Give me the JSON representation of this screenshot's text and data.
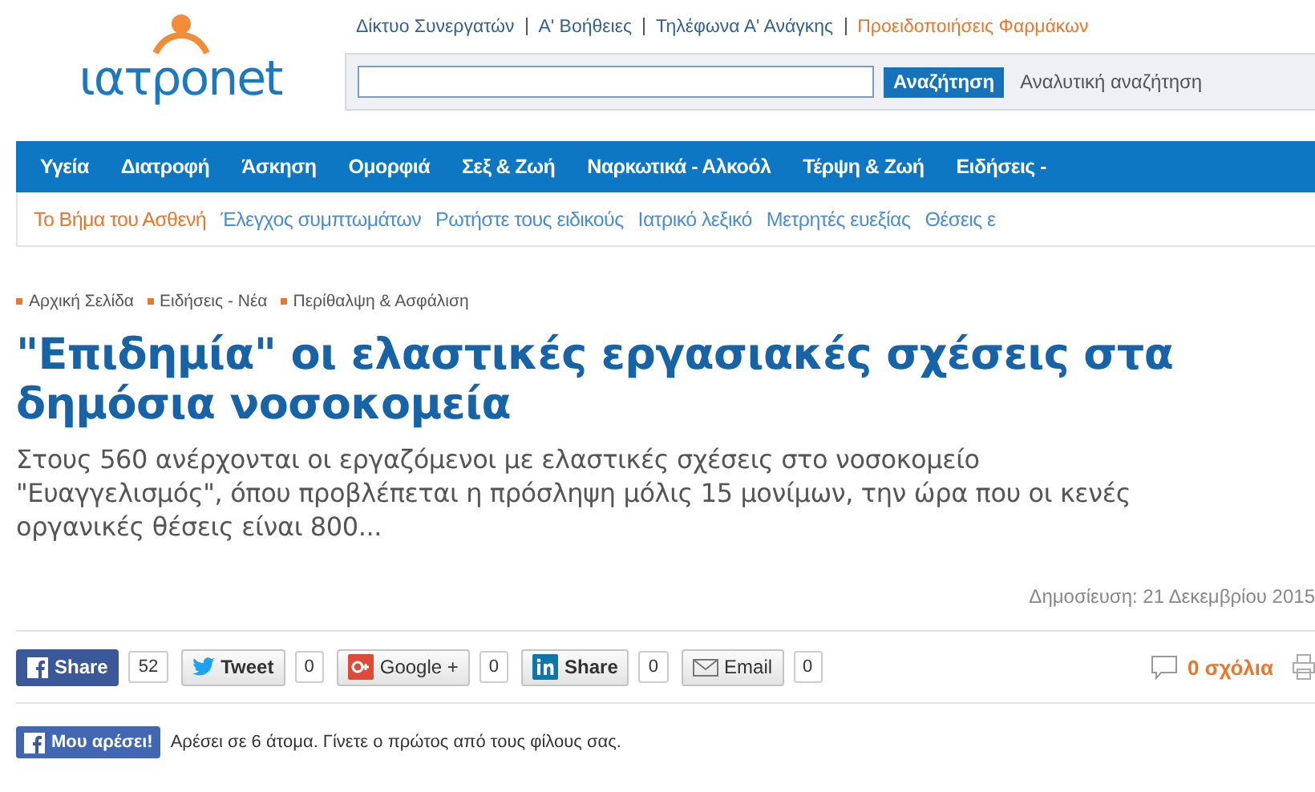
{
  "header": {
    "logo": {
      "prefix": "ιατρο",
      "suffix": "net"
    },
    "top_links": [
      {
        "label": "Δίκτυο Συνεργατών",
        "highlight": false
      },
      {
        "label": "Α' Βοήθειες",
        "highlight": false
      },
      {
        "label": "Τηλέφωνα Α' Ανάγκης",
        "highlight": false
      },
      {
        "label": "Προειδοποιήσεις Φαρμάκων",
        "highlight": true
      }
    ],
    "search": {
      "button": "Αναζήτηση",
      "advanced": "Αναλυτική αναζήτηση"
    }
  },
  "main_nav": [
    "Υγεία",
    "Διατροφή",
    "Άσκηση",
    "Ομορφιά",
    "Σεξ & Ζωή",
    "Ναρκωτικά - Αλκοόλ",
    "Τέρψη & Ζωή",
    "Ειδήσεις -"
  ],
  "sub_nav": [
    {
      "label": "Το Βήμα του Ασθενή",
      "selected": true
    },
    {
      "label": "Έλεγχος συμπτωμάτων",
      "selected": false
    },
    {
      "label": "Ρωτήστε τους ειδικούς",
      "selected": false
    },
    {
      "label": "Ιατρικό λεξικό",
      "selected": false
    },
    {
      "label": "Μετρητές ευεξίας",
      "selected": false
    },
    {
      "label": "Θέσεις ε",
      "selected": false
    }
  ],
  "breadcrumb": [
    "Αρχική Σελίδα",
    "Ειδήσεις - Νέα",
    "Περίθαλψη & Ασφάλιση"
  ],
  "article": {
    "title": "\"Επιδημία\" οι ελαστικές εργασιακές σχέσεις στα δημόσια νοσοκομεία",
    "lead": "Στους 560 ανέρχονται οι εργαζόμενοι με ελαστικές σχέσεις στο νοσοκομείο \"Ευαγγελισμός\", όπου προβλέπεται η πρόσληψη μόλις 15 μονίμων, την ώρα που οι κενές οργανικές θέσεις είναι 800...",
    "published": "Δημοσίευση: 21 Δεκεμβρίου 2015"
  },
  "share_buttons": [
    {
      "kind": "facebook",
      "label": "Share",
      "count": "52"
    },
    {
      "kind": "twitter",
      "label": "Tweet",
      "count": "0"
    },
    {
      "kind": "google",
      "label": "Google +",
      "count": "0"
    },
    {
      "kind": "linkedin",
      "label": "Share",
      "count": "0"
    },
    {
      "kind": "email",
      "label": "Email",
      "count": "0"
    }
  ],
  "comments": "0 σχόλια",
  "like": {
    "button": "Μου αρέσει!",
    "text": "Αρέσει σε 6 άτομα. Γίνετε ο πρώτος από τους φίλους σας."
  }
}
